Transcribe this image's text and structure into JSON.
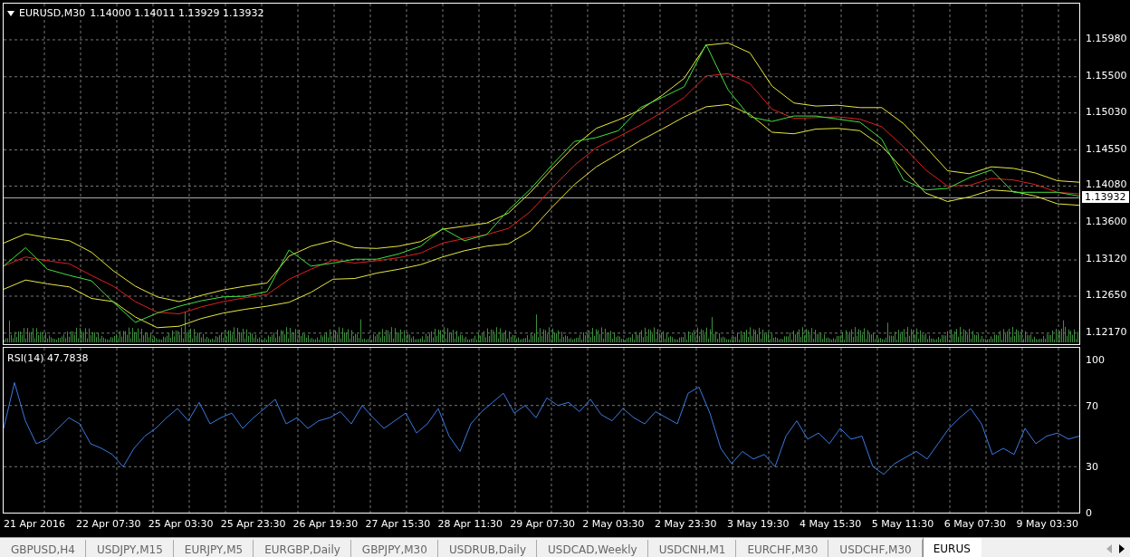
{
  "chart": {
    "symbol": "EURUSD,M30",
    "ohlc": "1.14000 1.14011 1.13929 1.13932",
    "chart_data": {
      "type": "line",
      "ylim": [
        1.1205,
        1.1645
      ],
      "grid": true,
      "ref_lines": [
        {
          "axis": "y",
          "value": 1.13932,
          "label": "1.13932",
          "color": "#aaaaaa"
        }
      ],
      "yticks": [
        {
          "value": 1.1598,
          "label": "1.15980"
        },
        {
          "value": 1.155,
          "label": "1.15500"
        },
        {
          "value": 1.1503,
          "label": "1.15030"
        },
        {
          "value": 1.1455,
          "label": "1.14550"
        },
        {
          "value": 1.1408,
          "label": "1.14080"
        },
        {
          "value": 1.136,
          "label": "1.13600"
        },
        {
          "value": 1.1312,
          "label": "1.13120"
        },
        {
          "value": 1.1265,
          "label": "1.12650"
        },
        {
          "value": 1.1217,
          "label": "1.12170"
        }
      ],
      "series": [
        {
          "color": "#e8e840",
          "values": [
            1.1334,
            1.1346,
            1.1341,
            1.1337,
            1.1322,
            1.1298,
            1.1278,
            1.1264,
            1.1258,
            1.1266,
            1.1273,
            1.1278,
            1.1282,
            1.1317,
            1.133,
            1.1337,
            1.1328,
            1.1327,
            1.133,
            1.1336,
            1.1352,
            1.1356,
            1.136,
            1.1373,
            1.14,
            1.1431,
            1.146,
            1.1483,
            1.1494,
            1.1507,
            1.1526,
            1.1548,
            1.1591,
            1.1594,
            1.1581,
            1.1538,
            1.1516,
            1.1512,
            1.1513,
            1.151,
            1.151,
            1.1489,
            1.1459,
            1.1428,
            1.1424,
            1.1433,
            1.1431,
            1.1425,
            1.1415,
            1.1413
          ]
        },
        {
          "color": "#e8e840",
          "values": [
            1.1274,
            1.1286,
            1.1281,
            1.1277,
            1.1262,
            1.1258,
            1.1238,
            1.1224,
            1.1226,
            1.1236,
            1.1243,
            1.1248,
            1.1252,
            1.1257,
            1.127,
            1.1287,
            1.1288,
            1.1295,
            1.13,
            1.1306,
            1.1316,
            1.1324,
            1.133,
            1.1333,
            1.135,
            1.1381,
            1.141,
            1.1433,
            1.145,
            1.1467,
            1.1482,
            1.1498,
            1.1511,
            1.1514,
            1.1501,
            1.1478,
            1.1476,
            1.1482,
            1.1483,
            1.148,
            1.146,
            1.1429,
            1.1399,
            1.1388,
            1.1394,
            1.1403,
            1.1401,
            1.1395,
            1.1385,
            1.1383
          ]
        },
        {
          "color": "#e02020",
          "values": [
            1.1304,
            1.1316,
            1.1311,
            1.1307,
            1.1292,
            1.1278,
            1.1258,
            1.1244,
            1.1242,
            1.1251,
            1.1258,
            1.1263,
            1.1267,
            1.1287,
            1.13,
            1.1312,
            1.1308,
            1.1311,
            1.1315,
            1.1321,
            1.1334,
            1.134,
            1.1345,
            1.1353,
            1.1375,
            1.1406,
            1.1435,
            1.1458,
            1.1472,
            1.1487,
            1.1504,
            1.1523,
            1.1551,
            1.1554,
            1.1541,
            1.1508,
            1.1496,
            1.1497,
            1.1498,
            1.1495,
            1.1485,
            1.1459,
            1.1429,
            1.1408,
            1.1409,
            1.1418,
            1.1416,
            1.141,
            1.14,
            1.1398
          ]
        },
        {
          "color": "#40e040",
          "values": [
            1.1304,
            1.1328,
            1.13,
            1.1292,
            1.1285,
            1.1257,
            1.1231,
            1.1243,
            1.1252,
            1.1259,
            1.1264,
            1.1265,
            1.1271,
            1.1325,
            1.1304,
            1.1308,
            1.1313,
            1.1313,
            1.132,
            1.133,
            1.1353,
            1.1337,
            1.1345,
            1.1377,
            1.1404,
            1.1436,
            1.1466,
            1.1471,
            1.148,
            1.151,
            1.1523,
            1.1537,
            1.1592,
            1.1533,
            1.1498,
            1.1492,
            1.1499,
            1.1499,
            1.1495,
            1.1491,
            1.1469,
            1.1416,
            1.1403,
            1.1405,
            1.1419,
            1.1429,
            1.14,
            1.14,
            1.14,
            1.1395
          ]
        }
      ]
    }
  },
  "indicator": {
    "label": "RSI(14) 47.7838",
    "chart_data": {
      "type": "line",
      "ylim": [
        -1.2,
        107.7
      ],
      "grid": true,
      "yticks": [
        {
          "value": 100,
          "label": "100"
        },
        {
          "value": 70,
          "label": "70"
        },
        {
          "value": 30,
          "label": "30"
        },
        {
          "value": 0,
          "label": "0"
        }
      ],
      "series": [
        {
          "color": "#3a7ae0",
          "values": [
            55,
            85,
            60,
            45,
            48,
            55,
            62,
            58,
            45,
            42,
            38,
            30,
            42,
            50,
            55,
            62,
            68,
            60,
            72,
            58,
            62,
            65,
            55,
            62,
            68,
            74,
            58,
            62,
            55,
            60,
            62,
            66,
            58,
            70,
            62,
            55,
            60,
            65,
            52,
            58,
            68,
            50,
            40,
            58,
            66,
            72,
            78,
            65,
            70,
            62,
            75,
            70,
            72,
            66,
            74,
            64,
            60,
            68,
            62,
            58,
            66,
            62,
            58,
            78,
            82,
            65,
            42,
            32,
            40,
            35,
            38,
            30,
            50,
            60,
            48,
            52,
            45,
            55,
            48,
            50,
            30,
            25,
            32,
            36,
            40,
            35,
            45,
            55,
            62,
            68,
            58,
            38,
            42,
            38,
            55,
            45,
            50,
            52,
            48,
            50
          ]
        }
      ]
    }
  },
  "time_axis": [
    "21 Apr 2016",
    "22 Apr 07:30",
    "25 Apr 03:30",
    "25 Apr 23:30",
    "26 Apr 19:30",
    "27 Apr 15:30",
    "28 Apr 11:30",
    "29 Apr 07:30",
    "2 May 03:30",
    "2 May 23:30",
    "3 May 19:30",
    "4 May 15:30",
    "5 May 11:30",
    "6 May 07:30",
    "9 May 03:30"
  ],
  "tabs": [
    {
      "label": "GBPUSD,H4",
      "selected": false
    },
    {
      "label": "USDJPY,M15",
      "selected": false
    },
    {
      "label": "EURJPY,M5",
      "selected": false
    },
    {
      "label": "EURGBP,Daily",
      "selected": false
    },
    {
      "label": "GBPJPY,M30",
      "selected": false
    },
    {
      "label": "USDRUB,Daily",
      "selected": false
    },
    {
      "label": "USDCAD,Weekly",
      "selected": false
    },
    {
      "label": "USDCNH,M1",
      "selected": false
    },
    {
      "label": "EURCHF,M30",
      "selected": false
    },
    {
      "label": "USDCHF,M30",
      "selected": false
    },
    {
      "label": "EURUS",
      "selected": true
    }
  ]
}
